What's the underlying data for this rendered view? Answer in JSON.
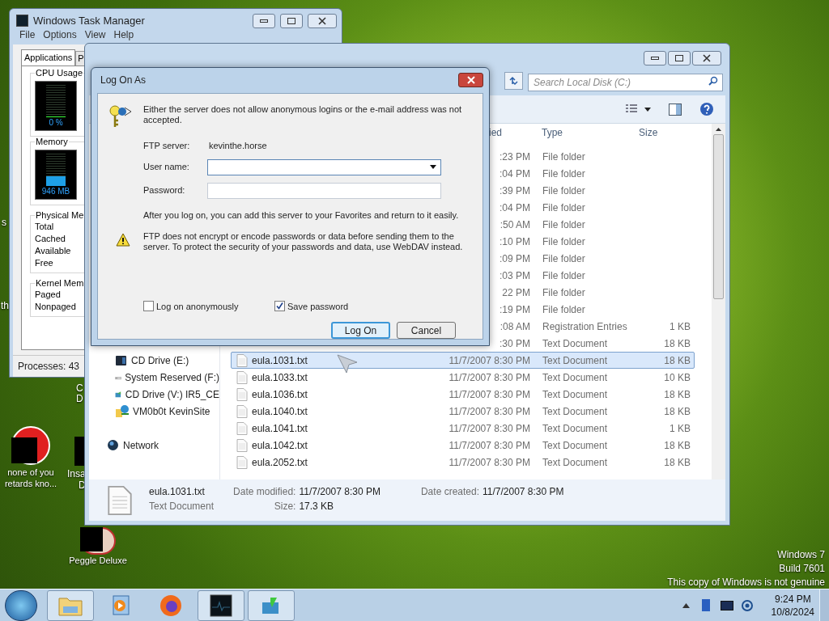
{
  "desktop": {
    "icons": [
      {
        "label": "none of you retards kno..."
      },
      {
        "label": "Peggle Deluxe"
      }
    ],
    "label_fragments": [
      "s",
      "th",
      "C",
      "D",
      "Insa",
      "D"
    ],
    "notice": [
      "Windows 7",
      "Build 7601",
      "This copy of Windows is not genuine"
    ]
  },
  "task_manager": {
    "title": "Windows Task Manager",
    "menu": [
      "File",
      "Options",
      "View",
      "Help"
    ],
    "tabs": [
      {
        "label": "Applications",
        "selected": true
      },
      {
        "label": "P",
        "selected": false
      }
    ],
    "meters": [
      {
        "label": "CPU Usage",
        "reading": "0 %",
        "level": 0
      },
      {
        "label": "Memory",
        "reading": "946 MB",
        "level": 0.3
      }
    ],
    "groups": [
      {
        "title": "Physical Me",
        "rows": [
          "Total",
          "Cached",
          "Available",
          "Free"
        ]
      },
      {
        "title": "Kernel Mem",
        "rows": [
          "Paged",
          "Nonpaged"
        ]
      }
    ],
    "status": "Processes: 43"
  },
  "explorer": {
    "search": {
      "placeholder": "Search Local Disk (C:)"
    },
    "columns": [
      "ied",
      "Type",
      "Size"
    ],
    "rows": [
      {
        "date": ":23 PM",
        "type": "File folder",
        "selected": false
      },
      {
        "date": ":04 PM",
        "type": "File folder",
        "selected": false
      },
      {
        "date": ":39 PM",
        "type": "File folder",
        "selected": false
      },
      {
        "date": ":04 PM",
        "type": "File folder",
        "selected": false
      },
      {
        "date": ":50 AM",
        "type": "File folder",
        "selected": false
      },
      {
        "date": ":10 PM",
        "type": "File folder",
        "selected": false
      },
      {
        "date": ":09 PM",
        "type": "File folder",
        "selected": false
      },
      {
        "date": ":03 PM",
        "type": "File folder",
        "selected": false
      },
      {
        "date": "22 PM",
        "type": "File folder",
        "selected": false
      },
      {
        "date": ":19 PM",
        "type": "File folder",
        "selected": false
      },
      {
        "date": ":08 AM",
        "type": "Registration Entries",
        "size": "1 KB",
        "selected": false
      },
      {
        "date": ":30 PM",
        "type": "Text Document",
        "size": "18 KB",
        "selected": false
      },
      {
        "name": "eula.1031.txt",
        "date": "11/7/2007 8:30 PM",
        "type": "Text Document",
        "size": "18 KB",
        "selected": true
      },
      {
        "name": "eula.1033.txt",
        "date": "11/7/2007 8:30 PM",
        "type": "Text Document",
        "size": "10 KB",
        "selected": false
      },
      {
        "name": "eula.1036.txt",
        "date": "11/7/2007 8:30 PM",
        "type": "Text Document",
        "size": "18 KB",
        "selected": false
      },
      {
        "name": "eula.1040.txt",
        "date": "11/7/2007 8:30 PM",
        "type": "Text Document",
        "size": "18 KB",
        "selected": false
      },
      {
        "name": "eula.1041.txt",
        "date": "11/7/2007 8:30 PM",
        "type": "Text Document",
        "size": "1 KB",
        "selected": false
      },
      {
        "name": "eula.1042.txt",
        "date": "11/7/2007 8:30 PM",
        "type": "Text Document",
        "size": "18 KB",
        "selected": false
      },
      {
        "name": "eula.2052.txt",
        "date": "11/7/2007 8:30 PM",
        "type": "Text Document",
        "size": "18 KB",
        "selected": false
      }
    ],
    "drives": [
      {
        "label": "CD Drive (E:)",
        "kind": "cd"
      },
      {
        "label": "System Reserved (F:)",
        "kind": "disk"
      },
      {
        "label": "CD Drive (V:) IR5_CE",
        "kind": "install"
      },
      {
        "label": "VM0b0t KevinSite",
        "kind": "site"
      }
    ],
    "network": {
      "label": "Network"
    },
    "details": {
      "name": "eula.1031.txt",
      "type": "Text Document",
      "props": [
        {
          "label": "Date modified:",
          "value": "11/7/2007 8:30 PM"
        },
        {
          "label": "Size:",
          "value": "17.3 KB"
        },
        {
          "label": "Date created:",
          "value": "11/7/2007 8:30 PM"
        }
      ]
    }
  },
  "dialog": {
    "title": "Log On As",
    "message": "Either the server does not allow anonymous logins or the e-mail address was not accepted.",
    "server": {
      "label": "FTP server:",
      "value": "kevinthe.horse"
    },
    "fields": [
      {
        "label": "User name:",
        "kind": "combo"
      },
      {
        "label": "Password:",
        "kind": "text"
      }
    ],
    "info": "After you log on, you can add this server to your Favorites and return to it easily.",
    "warning": "FTP does not encrypt or encode passwords or data before sending them to the server.  To protect the security of your passwords and data, use WebDAV instead.",
    "checkboxes": [
      {
        "label": "Log on anonymously",
        "checked": false
      },
      {
        "label": "Save password",
        "checked": true
      }
    ],
    "buttons": [
      {
        "label": "Log On",
        "default": true
      },
      {
        "label": "Cancel",
        "default": false
      }
    ]
  },
  "taskbar": {
    "items": [
      {
        "kind": "folder",
        "open": true
      },
      {
        "kind": "media",
        "open": false
      },
      {
        "kind": "browser",
        "open": false
      },
      {
        "kind": "monitor",
        "open": true
      },
      {
        "kind": "app",
        "open": true
      }
    ],
    "time": "9:24 PM",
    "date": "10/8/2024"
  }
}
